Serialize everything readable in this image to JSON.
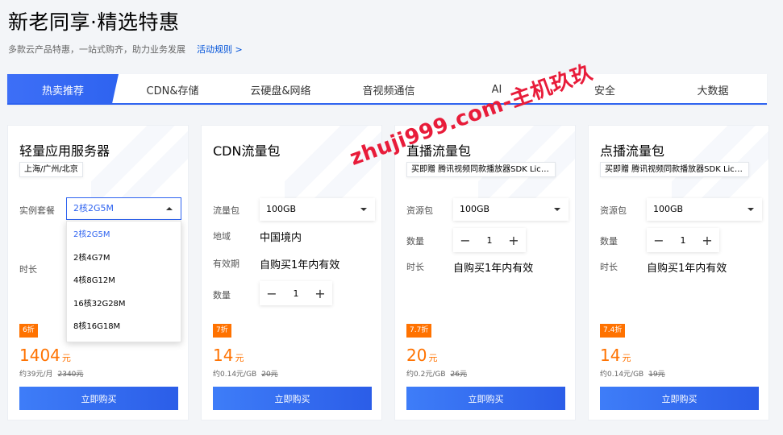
{
  "header": {
    "title": "新老同享·精选特惠",
    "subtitle": "多款云产品特惠，一站式购齐，助力业务发展",
    "rules_link": "活动规则 >"
  },
  "tabs": [
    {
      "label": "热卖推荐"
    },
    {
      "label": "CDN&存储"
    },
    {
      "label": "云硬盘&网络"
    },
    {
      "label": "音视频通信"
    },
    {
      "label": "AI"
    },
    {
      "label": "安全"
    },
    {
      "label": "大数据"
    }
  ],
  "cards": [
    {
      "title": "轻量应用服务器",
      "tag": "上海/广州/北京",
      "labels": {
        "instance": "实例套餐",
        "duration": "时长"
      },
      "select_value": "2核2G5M",
      "dropdown": [
        "2核2G5M",
        "2核4G7M",
        "4核8G12M",
        "16核32G28M",
        "8核16G18M"
      ],
      "discount": "6折",
      "price": "1404",
      "price_unit": "元",
      "sub": "约39元/月",
      "original": "2340元",
      "buy": "立即购买"
    },
    {
      "title": "CDN流量包",
      "labels": {
        "pkg": "流量包",
        "region": "地域",
        "validity": "有效期",
        "qty": "数量"
      },
      "select_value": "100GB",
      "region": "中国境内",
      "validity": "自购买1年内有效",
      "quantity": "1",
      "discount": "7折",
      "price": "14",
      "price_unit": "元",
      "sub": "约0.14元/GB",
      "original": "20元",
      "buy": "立即购买"
    },
    {
      "title": "直播流量包",
      "tag": "买即赠 腾讯视频同款播放器SDK License",
      "labels": {
        "pkg": "资源包",
        "qty": "数量",
        "duration": "时长"
      },
      "select_value": "100GB",
      "quantity": "1",
      "validity": "自购买1年内有效",
      "discount": "7.7折",
      "price": "20",
      "price_unit": "元",
      "sub": "约0.2元/GB",
      "original": "26元",
      "buy": "立即购买"
    },
    {
      "title": "点播流量包",
      "tag": "买即赠 腾讯视频同款播放器SDK License",
      "labels": {
        "pkg": "资源包",
        "qty": "数量",
        "duration": "时长"
      },
      "select_value": "100GB",
      "quantity": "1",
      "validity": "自购买1年内有效",
      "discount": "7.4折",
      "price": "14",
      "price_unit": "元",
      "sub": "约0.14元/GB",
      "original": "19元",
      "buy": "立即购买"
    }
  ],
  "watermark": "zhuji999.com-主机玖玖",
  "colors": {
    "accent": "#2e63f0",
    "price": "#ff7200",
    "watermark": "#e81c3a"
  }
}
